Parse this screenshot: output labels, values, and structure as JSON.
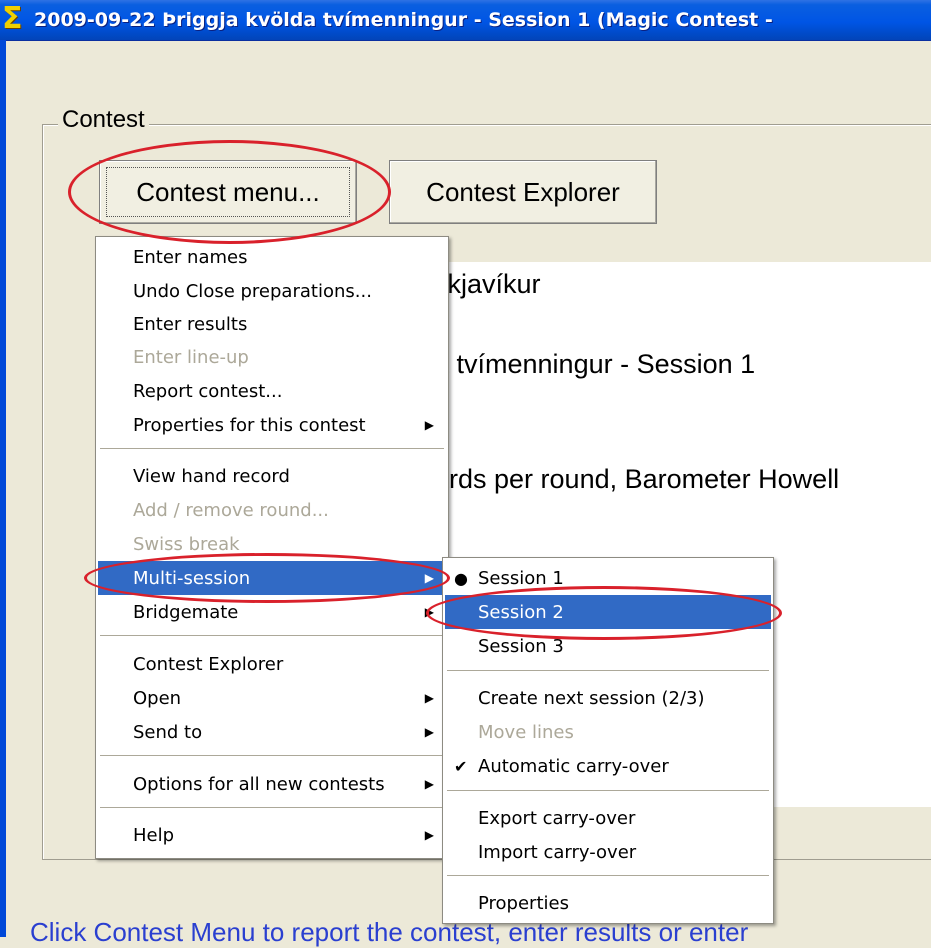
{
  "window": {
    "title": "2009-09-22  Þriggja kvölda tvímenningur - Session 1  (Magic Contest - ",
    "icon": "sigma-icon"
  },
  "group": {
    "legend": "Contest"
  },
  "buttons": {
    "menu": "Contest menu...",
    "explorer": "Contest Explorer"
  },
  "panel": {
    "line1": "ykjavíkur",
    "line2": "a tvímenningur - Session 1",
    "line3": ")",
    "line4": "ards per round, Barometer Howell"
  },
  "status": {
    "text": "Click Contest Menu to report the contest, enter results or enter"
  },
  "contest_menu": {
    "items": [
      {
        "label": "Enter names"
      },
      {
        "label": "Undo Close preparations..."
      },
      {
        "label": "Enter results"
      },
      {
        "label": "Enter line-up",
        "disabled": true
      },
      {
        "label": "Report contest..."
      },
      {
        "label": "Properties for this contest",
        "submenu": true
      },
      {
        "label": "View hand record"
      },
      {
        "label": "Add / remove round...",
        "disabled": true
      },
      {
        "label": "Swiss break",
        "disabled": true
      },
      {
        "label": "Multi-session",
        "submenu": true,
        "selected": true
      },
      {
        "label": "Bridgemate",
        "submenu": true
      },
      {
        "label": "Contest Explorer"
      },
      {
        "label": "Open",
        "submenu": true
      },
      {
        "label": "Send to",
        "submenu": true
      },
      {
        "label": "Options for all new contests",
        "submenu": true
      },
      {
        "label": "Help",
        "submenu": true
      }
    ]
  },
  "multisession_menu": {
    "items": [
      {
        "label": "Session 1",
        "mark": "●"
      },
      {
        "label": "Session 2",
        "selected": true
      },
      {
        "label": "Session 3"
      },
      {
        "label": "Create next session (2/3)"
      },
      {
        "label": "Move lines",
        "disabled": true
      },
      {
        "label": "Automatic carry-over",
        "mark": "✔"
      },
      {
        "label": "Export carry-over"
      },
      {
        "label": "Import carry-over"
      },
      {
        "label": "Properties"
      }
    ]
  },
  "annotation_color": "#d9212b",
  "highlight_color": "#316ac5"
}
